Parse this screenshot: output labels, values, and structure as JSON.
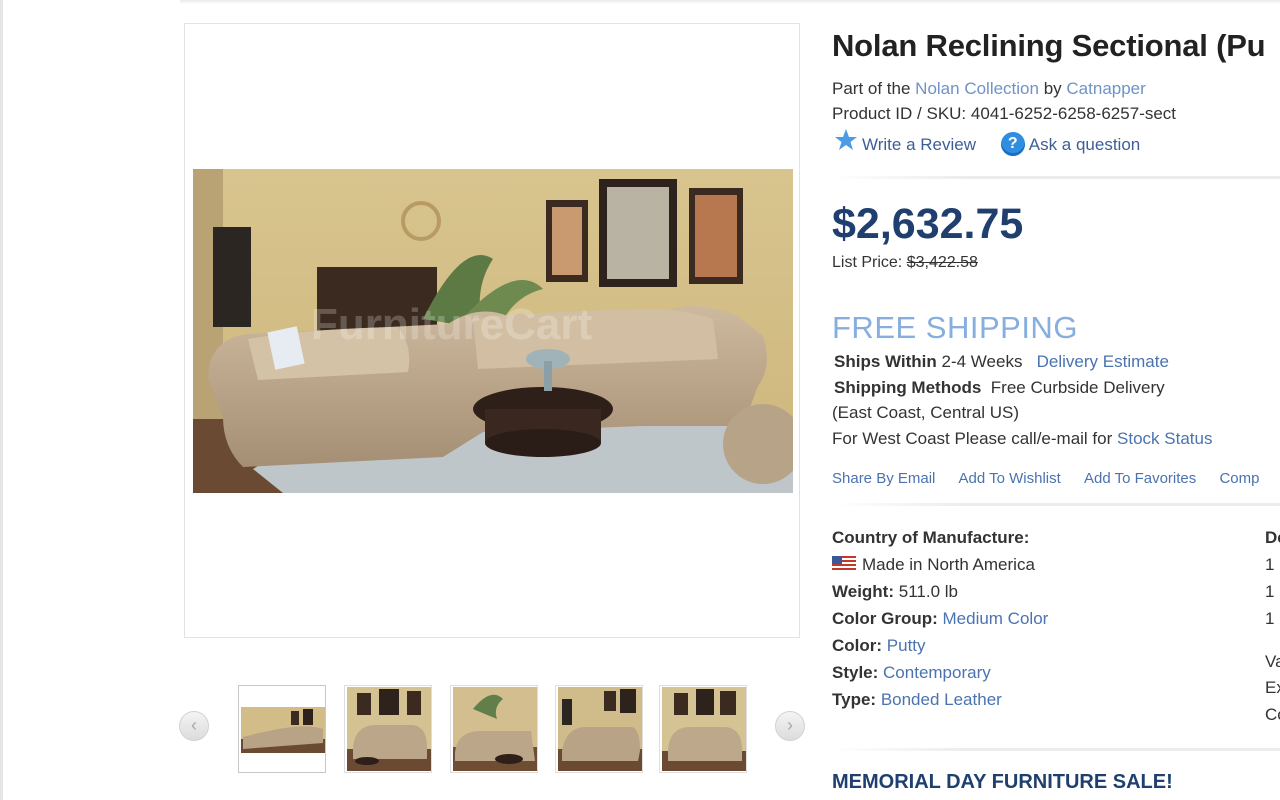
{
  "product": {
    "title": "Nolan Reclining Sectional (Pu",
    "part_of_prefix": "Part of the",
    "collection_link": "Nolan Collection",
    "by_text": "by",
    "brand_link": "Catnapper",
    "sku_label": "Product ID / SKU:",
    "sku_value": "4041-6252-6258-6257-sect",
    "write_review": "Write a Review",
    "ask_question": "Ask a question"
  },
  "pricing": {
    "price": "$2,632.75",
    "list_price_label": "List Price:",
    "list_price_value": "$3,422.58"
  },
  "shipping": {
    "free_shipping": "FREE SHIPPING",
    "ships_within_label": "Ships Within",
    "ships_within_value": "2-4 Weeks",
    "delivery_estimate_link": "Delivery Estimate",
    "methods_label": "Shipping Methods",
    "methods_value": "Free Curbside Delivery",
    "regions": "(East Coast, Central US)",
    "west_coast_text": "For West Coast Please call/e-mail for",
    "stock_status_link": "Stock Status"
  },
  "actions": [
    "Share By Email",
    "Add To Wishlist",
    "Add To Favorites",
    "Comp"
  ],
  "specs": {
    "country_label": "Country of Manufacture:",
    "country_value": "Made in North America",
    "weight_label": "Weight:",
    "weight_value": "511.0 lb",
    "color_group_label": "Color Group:",
    "color_group_value": "Medium Color",
    "color_label": "Color:",
    "color_value": "Putty",
    "style_label": "Style:",
    "style_value": "Contemporary",
    "type_label": "Type:",
    "type_value": "Bonded Leather"
  },
  "right_column": [
    "De",
    "1",
    "1",
    "1",
    "Va",
    "Ex",
    "Co"
  ],
  "promo": {
    "sale_banner": "MEMORIAL DAY FURNITURE SALE!"
  },
  "gallery": {
    "prev_icon": "‹",
    "next_icon": "›",
    "watermark": "FurnitureCart",
    "thumbnails": 5
  },
  "colors": {
    "link": "#4a73b0",
    "price": "#1f3f6e",
    "free_shipping": "#86aede",
    "help_icon": "#2f8ee0",
    "star_icon": "#4d9be6"
  }
}
